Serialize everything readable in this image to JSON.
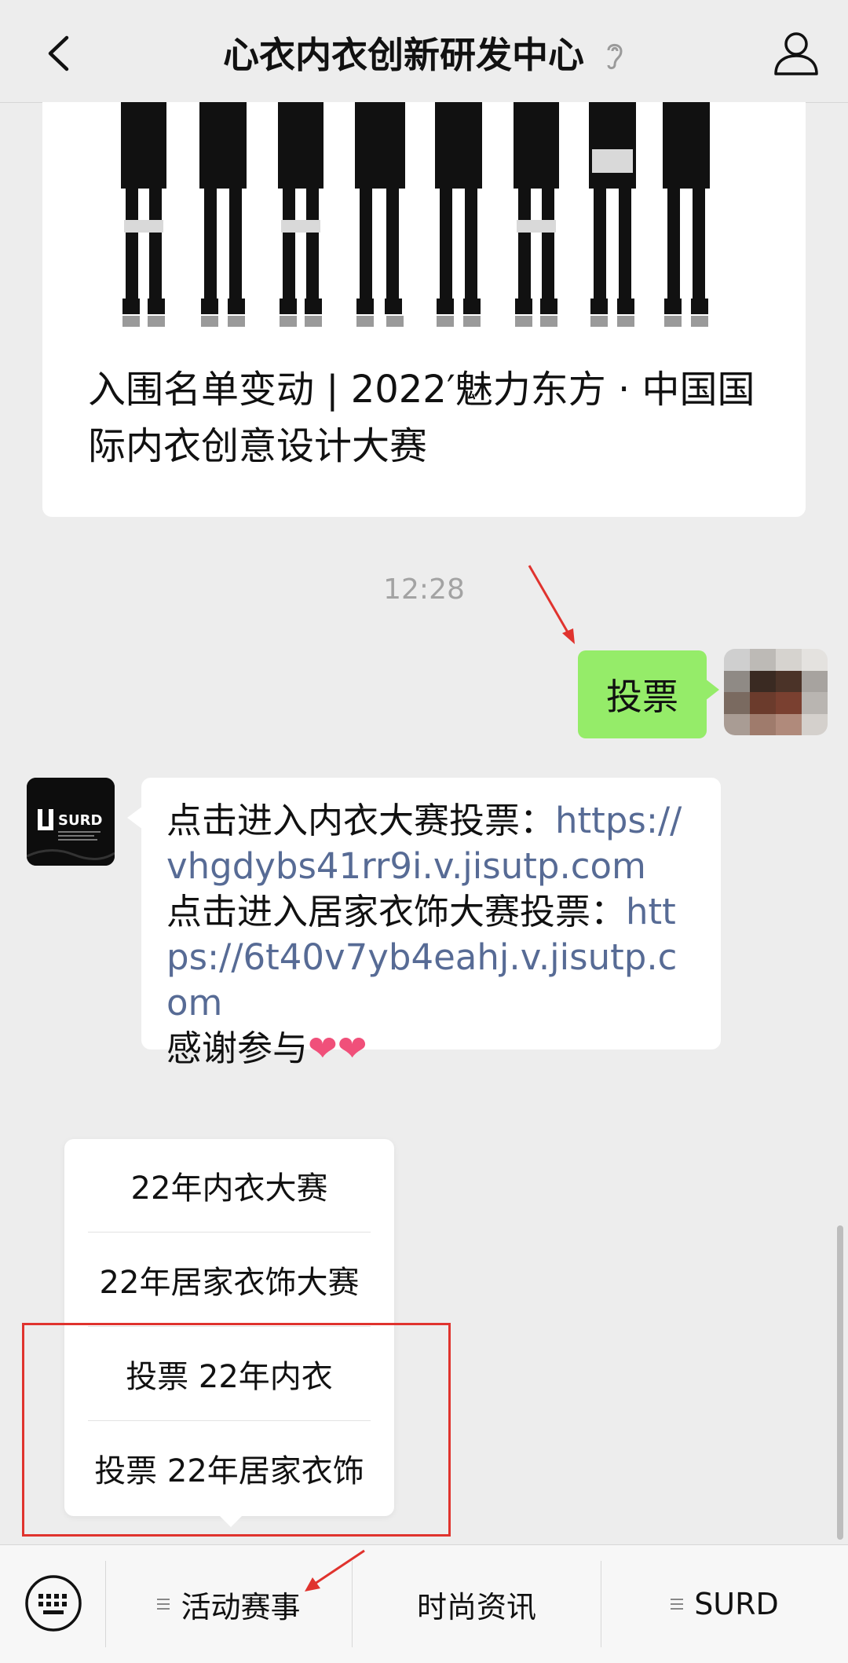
{
  "header": {
    "title": "心衣内衣创新研发中心",
    "back_icon": "chevron-left-icon",
    "ear_icon": "ear-icon",
    "profile_icon": "person-icon"
  },
  "article_card": {
    "title": "入围名单变动 | 2022′魅力东方 · 中国国际内衣创意设计大赛"
  },
  "chat": {
    "timestamp": "12:28",
    "outgoing_message": "投票",
    "incoming_message": {
      "line1_text": "点击进入内衣大赛投票：",
      "line1_link": "https://vhgdybs41rr9i.v.jisutp.com",
      "line2_text": "点击进入居家衣饰大赛投票：",
      "line2_link": "https://6t40v7yb4eahj.v.jisutp.com",
      "line3_text": "感谢参与",
      "emoji": "❤❤"
    },
    "sender_logo_text": "SURD"
  },
  "popup_menu": {
    "items": [
      "22年内衣大赛",
      "22年居家衣饰大赛",
      "投票 22年内衣",
      "投票 22年居家衣饰"
    ]
  },
  "bottom_bar": {
    "tabs": [
      "活动赛事",
      "时尚资讯",
      "SURD"
    ],
    "keyboard_icon": "keyboard-icon"
  },
  "colors": {
    "outgoing_bubble": "#95ec69",
    "link": "#576b95",
    "annotation": "#e0332e",
    "background": "#ededed"
  }
}
